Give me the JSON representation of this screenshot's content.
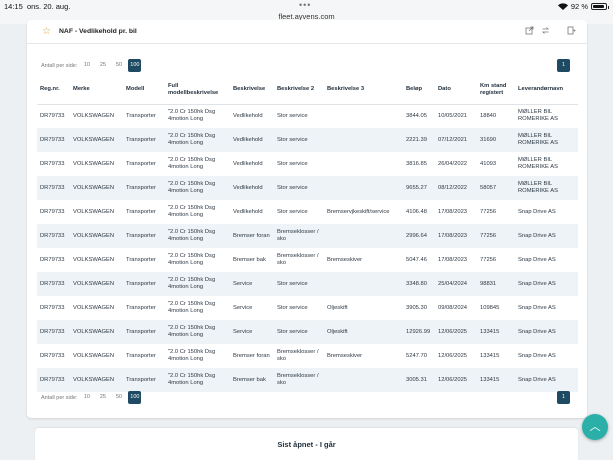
{
  "status": {
    "time": "14:15",
    "date": "ons. 20. aug.",
    "url": "fleet.ayvens.com",
    "battery": "92 %",
    "battery_level": 0.92
  },
  "card": {
    "title": "NAF - Vedlikehold pr. bil",
    "per_page_label": "Antall per side:",
    "per_page_options": [
      "10",
      "25",
      "50",
      "100"
    ],
    "per_page_selected": "100",
    "page": "1"
  },
  "table": {
    "headers": [
      "Reg.nr.",
      "Merke",
      "Modell",
      "Full modellbeskrivelse",
      "Beskrivelse",
      "Beskrivelse 2",
      "Beskrivelse 3",
      "Beløp",
      "Dato",
      "Km stand registert",
      "Leverandørnavn"
    ],
    "rows": [
      [
        "DR79733",
        "VOLKSWAGEN",
        "Transporter",
        "\"2.0 Cr 150hk Dsg 4motion Long",
        "Vedlikehold",
        "Stor service",
        "",
        "3844.05",
        "10/05/2021",
        "18840",
        "MØLLER BIL ROMERIKE AS"
      ],
      [
        "DR79733",
        "VOLKSWAGEN",
        "Transporter",
        "\"2.0 Cr 150hk Dsg 4motion Long",
        "Vedlikehold",
        "Stor service",
        "",
        "2221.39",
        "07/12/2021",
        "31690",
        "MØLLER BIL ROMERIKE AS"
      ],
      [
        "DR79733",
        "VOLKSWAGEN",
        "Transporter",
        "\"2.0 Cr 150hk Dsg 4motion Long",
        "Vedlikehold",
        "Stor service",
        "",
        "3816.85",
        "26/04/2022",
        "41093",
        "MØLLER BIL ROMERIKE AS"
      ],
      [
        "DR79733",
        "VOLKSWAGEN",
        "Transporter",
        "\"2.0 Cr 150hk Dsg 4motion Long",
        "Vedlikehold",
        "Stor service",
        "",
        "9655.27",
        "08/12/2022",
        "58057",
        "MØLLER BIL ROMERIKE AS"
      ],
      [
        "DR79733",
        "VOLKSWAGEN",
        "Transporter",
        "\"2.0 Cr 150hk Dsg 4motion Long",
        "Vedlikehold",
        "Stor service",
        "Bremservjkeskift/service",
        "4106.48",
        "17/08/2023",
        "77256",
        "Snap Drive AS"
      ],
      [
        "DR79733",
        "VOLKSWAGEN",
        "Transporter",
        "\"2.0 Cr 150hk Dsg 4motion Long",
        "Bremser foran",
        "Bremseklosser / sko",
        "",
        "2996.64",
        "17/08/2023",
        "77256",
        "Snap Drive AS"
      ],
      [
        "DR79733",
        "VOLKSWAGEN",
        "Transporter",
        "\"2.0 Cr 150hk Dsg 4motion Long",
        "Bremser bak",
        "Bremseklosser / sko",
        "Bremseskiver",
        "5047.46",
        "17/08/2023",
        "77256",
        "Snap Drive AS"
      ],
      [
        "DR79733",
        "VOLKSWAGEN",
        "Transporter",
        "\"2.0 Cr 150hk Dsg 4motion Long",
        "Service",
        "Stor service",
        "",
        "3348.80",
        "25/04/2024",
        "98831",
        "Snap Drive AS"
      ],
      [
        "DR79733",
        "VOLKSWAGEN",
        "Transporter",
        "\"2.0 Cr 150hk Dsg 4motion Long",
        "Service",
        "Stor service",
        "Oljeskift",
        "3905.30",
        "09/08/2024",
        "109845",
        "Snap Drive AS"
      ],
      [
        "DR79733",
        "VOLKSWAGEN",
        "Transporter",
        "\"2.0 Cr 150hk Dsg 4motion Long",
        "Service",
        "Stor service",
        "Oljeskift",
        "12926.99",
        "12/06/2025",
        "133415",
        "Snap Drive AS"
      ],
      [
        "DR79733",
        "VOLKSWAGEN",
        "Transporter",
        "\"2.0 Cr 150hk Dsg 4motion Long",
        "Bremser foran",
        "Bremseklosser / sko",
        "Bremseskiver",
        "5247.70",
        "12/06/2025",
        "133415",
        "Snap Drive AS"
      ],
      [
        "DR79733",
        "VOLKSWAGEN",
        "Transporter",
        "\"2.0 Cr 150hk Dsg 4motion Long",
        "Bremser bak",
        "Bremseklosser / sko",
        "",
        "3005.31",
        "12/06/2025",
        "133415",
        "Snap Drive AS"
      ]
    ]
  },
  "bottom": {
    "title": "Sist åpnet - I går"
  },
  "icons": {
    "star": "star-icon",
    "export": "export-icon",
    "refresh": "refresh-icon",
    "filter": "filter-icon",
    "scroll_top": "chevron-up-icon"
  },
  "colors": {
    "accent": "#1e4a63",
    "fab": "#2ab0a8",
    "row_alt": "#edf3f6",
    "star": "#d8a338"
  }
}
